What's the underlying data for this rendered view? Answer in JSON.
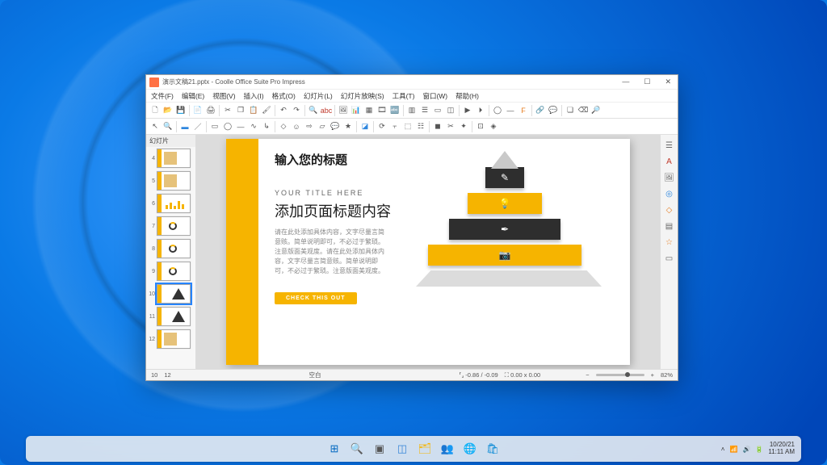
{
  "window": {
    "title": "演示文稿21.pptx - Coolle Office Suite Pro Impress"
  },
  "menu": {
    "file": "文件(F)",
    "edit": "编辑(E)",
    "view": "视图(V)",
    "insert": "插入(I)",
    "format": "格式(O)",
    "slide": "幻灯片(L)",
    "slideshow": "幻灯片放映(S)",
    "tools": "工具(T)",
    "window": "窗口(W)",
    "help": "帮助(H)"
  },
  "panel": {
    "header": "幻灯片"
  },
  "thumbs": [
    "4",
    "5",
    "6",
    "7",
    "8",
    "9",
    "10",
    "11",
    "12"
  ],
  "selected_index": 6,
  "slide": {
    "title": "输入您的标题",
    "eyebrow": "YOUR TITLE HERE",
    "subtitle": "添加页面标题内容",
    "body": "请在此处添加具体内容，文字尽量言简意赅。简单说明即可，不必过于繁琐。注意版面美观度。请在此处添加具体内容，文字尽量言简意赅。简单说明即可，不必过于繁琐。注意版面美观度。",
    "cta": "CHECK THIS OUT"
  },
  "pyramid": {
    "rows": [
      {
        "width": 48,
        "bg": "#2e2e2e",
        "icon": "✎"
      },
      {
        "width": 92,
        "bg": "#f6b400",
        "icon": "💡"
      },
      {
        "width": 138,
        "bg": "#2e2e2e",
        "icon": "✒"
      },
      {
        "width": 190,
        "bg": "#f6b400",
        "icon": "📷"
      }
    ]
  },
  "statusbar": {
    "slide": "10",
    "total": "12",
    "layout": "空白",
    "coords": "-0.86 / -0.09",
    "size": "0.00 x 0.00",
    "zoom": "82%"
  },
  "tray": {
    "date": "10/20/21",
    "time": "11:11 AM"
  },
  "taskbar": [
    {
      "name": "start",
      "glyph": "⊞",
      "color": "#0067c0"
    },
    {
      "name": "search",
      "glyph": "🔍",
      "color": "#555"
    },
    {
      "name": "taskview",
      "glyph": "▣",
      "color": "#555"
    },
    {
      "name": "widgets",
      "glyph": "◫",
      "color": "#3a88d8"
    },
    {
      "name": "explorer",
      "glyph": "🗂",
      "color": "#f6b400"
    },
    {
      "name": "teams",
      "glyph": "👥",
      "color": "#5558af"
    },
    {
      "name": "edge",
      "glyph": "🌐",
      "color": "#1e88e5"
    },
    {
      "name": "store",
      "glyph": "🛍",
      "color": "#0086d4"
    }
  ]
}
